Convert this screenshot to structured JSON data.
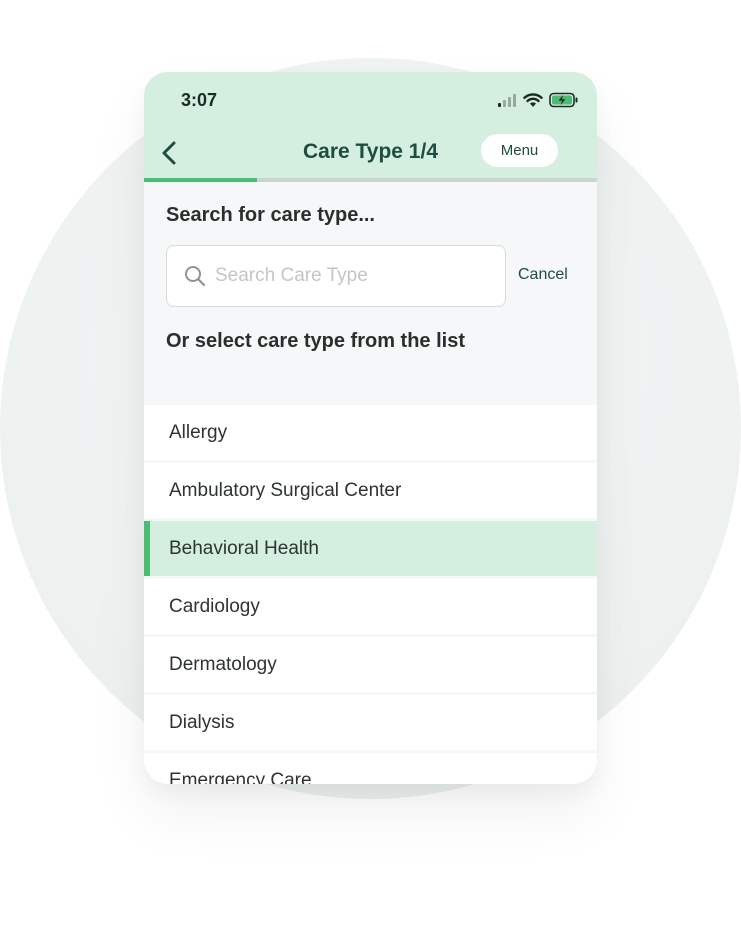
{
  "status_bar": {
    "time": "3:07"
  },
  "nav": {
    "title": "Care Type 1/4",
    "menu_label": "Menu"
  },
  "progress": {
    "step": 1,
    "total": 4,
    "fraction": 0.25
  },
  "search": {
    "heading": "Search for care type...",
    "placeholder": "Search Care Type",
    "cancel_label": "Cancel"
  },
  "list": {
    "heading": "Or select care type from the list",
    "items": [
      {
        "label": "Allergy",
        "selected": false
      },
      {
        "label": "Ambulatory Surgical Center",
        "selected": false
      },
      {
        "label": "Behavioral Health",
        "selected": true
      },
      {
        "label": "Cardiology",
        "selected": false
      },
      {
        "label": "Dermatology",
        "selected": false
      },
      {
        "label": "Dialysis",
        "selected": false
      },
      {
        "label": "Emergency Care",
        "selected": false
      }
    ]
  },
  "colors": {
    "header_bg": "#d4eee0",
    "accent": "#4cbc74",
    "title_text": "#1f4d3f"
  },
  "icons": [
    "back-chevron-icon",
    "signal-icon",
    "wifi-icon",
    "battery-charging-icon",
    "search-icon"
  ]
}
